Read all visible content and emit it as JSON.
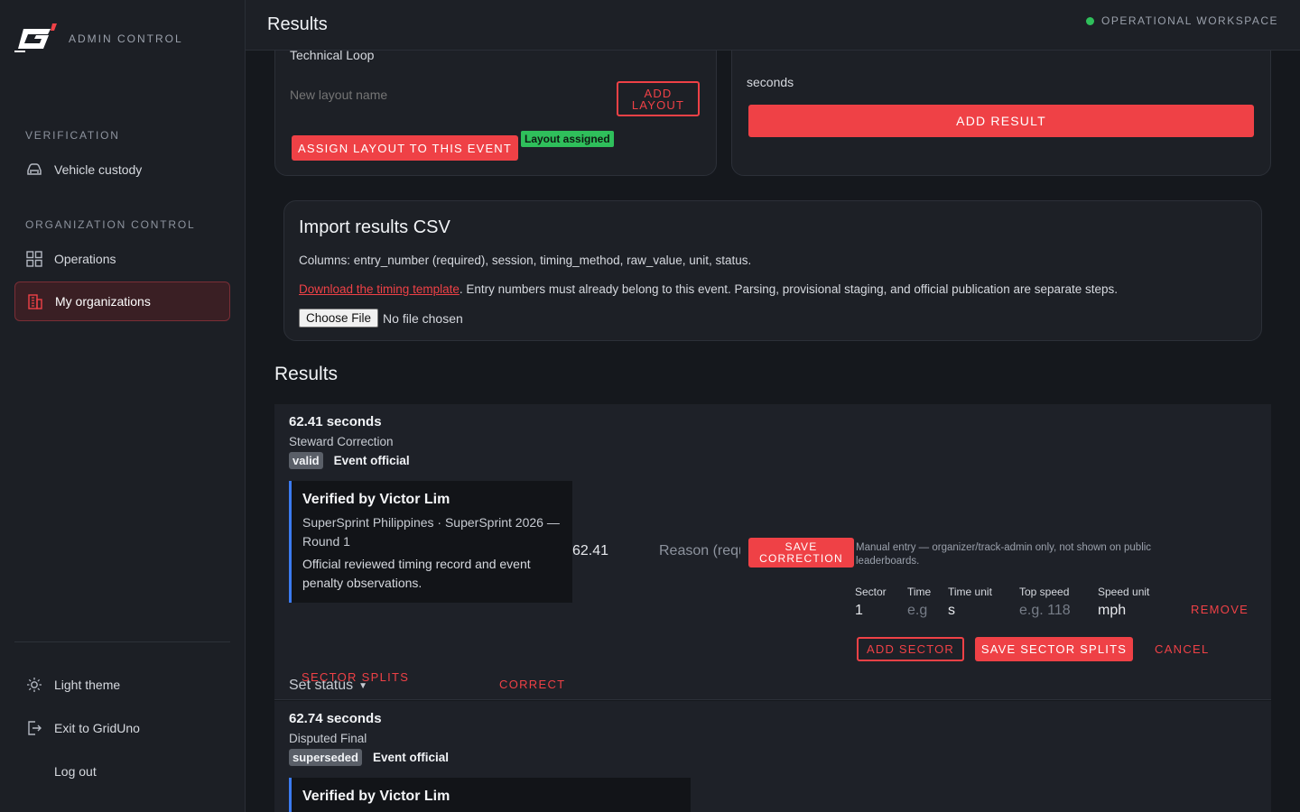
{
  "sidebar": {
    "brand_text": "ADMIN CONTROL",
    "sections": [
      {
        "title": "VERIFICATION",
        "items": [
          {
            "label": "Vehicle custody",
            "icon": "car-icon"
          }
        ]
      },
      {
        "title": "ORGANIZATION CONTROL",
        "items": [
          {
            "label": "Operations",
            "icon": "grid-icon"
          },
          {
            "label": "My organizations",
            "icon": "building-icon",
            "active": true
          }
        ]
      }
    ],
    "footer": {
      "theme": "Light theme",
      "exit": "Exit to GridUno",
      "logout": "Log out"
    }
  },
  "header": {
    "title": "Results",
    "workspace": "OPERATIONAL WORKSPACE"
  },
  "layout_card": {
    "current_layout": "Technical Loop",
    "new_layout_placeholder": "New layout name",
    "add_layout": "ADD LAYOUT",
    "assign_button": "ASSIGN LAYOUT TO THIS EVENT",
    "assigned_badge": "Layout assigned"
  },
  "add_result_card": {
    "unit": "seconds",
    "add_result": "ADD RESULT"
  },
  "import_card": {
    "title": "Import results CSV",
    "columns_text": "Columns: entry_number (required), session, timing_method, raw_value, unit, status.",
    "template_link": "Download the timing template",
    "template_note": ". Entry numbers must already belong to this event. Parsing, provisional staging, and official publication are separate steps.",
    "choose_file": "Choose File",
    "no_file": "No file chosen"
  },
  "results_heading": "Results",
  "results": [
    {
      "time": "62.41 seconds",
      "session": "Steward Correction",
      "status_badge": "valid",
      "scope": "Event official",
      "verified_by": "Verified by Victor Lim",
      "event": "SuperSprint Philippines · SuperSprint 2026 — Round 1",
      "note": "Official reviewed timing record and event penalty observations.",
      "correction_value": "62.41",
      "reason_placeholder": "Reason (required)",
      "save_correction": "SAVE CORRECTION",
      "set_status": "Set status",
      "correct": "CORRECT",
      "sector_splits": "SECTOR SPLITS",
      "manual_note": "Manual entry — organizer/track-admin only, not shown on public leaderboards.",
      "sector_fields": {
        "sector_label": "Sector",
        "sector_value": "1",
        "time_label": "Time",
        "time_placeholder": "e.g",
        "time_unit_label": "Time unit",
        "time_unit_value": "s",
        "top_speed_label": "Top speed",
        "top_speed_placeholder": "e.g. 118",
        "speed_unit_label": "Speed unit",
        "speed_unit_value": "mph",
        "remove": "REMOVE"
      },
      "add_sector": "ADD SECTOR",
      "save_splits": "SAVE SECTOR SPLITS",
      "cancel": "CANCEL"
    },
    {
      "time": "62.74 seconds",
      "session": "Disputed Final",
      "status_badge": "superseded",
      "scope": "Event official",
      "verified_by": "Verified by Victor Lim"
    }
  ],
  "colors": {
    "accent": "#ef4146",
    "success": "#2fbf5b",
    "info_border": "#3b7bf0"
  }
}
